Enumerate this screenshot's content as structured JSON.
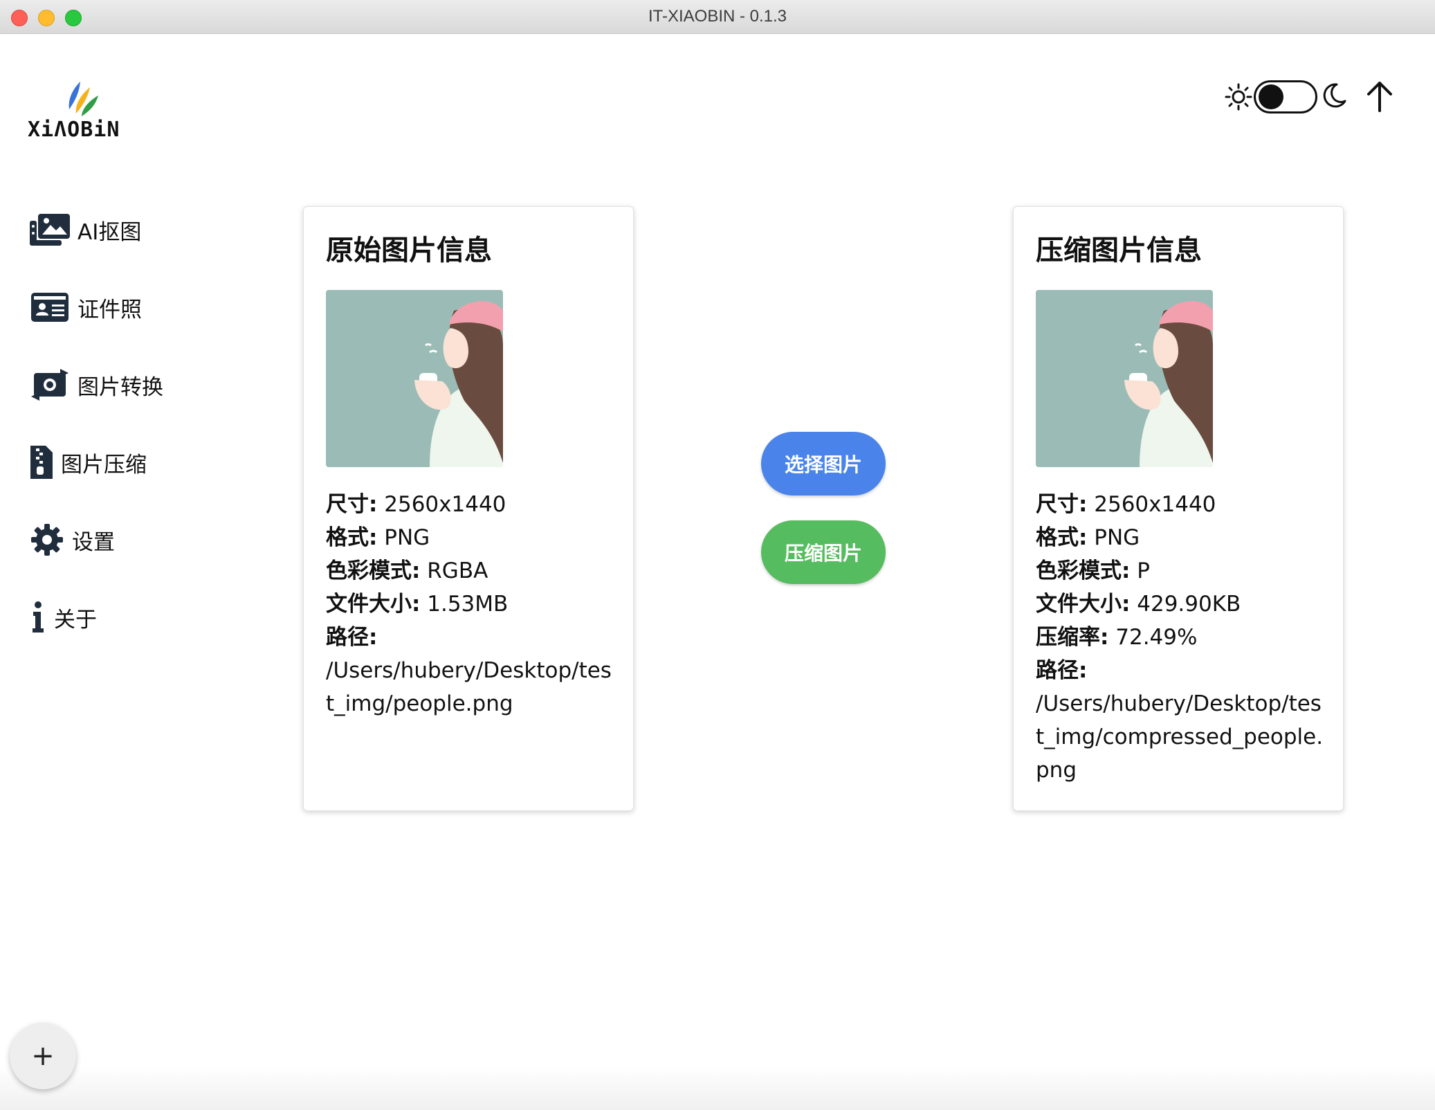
{
  "window": {
    "title": "IT-XIAOBIN - 0.1.3"
  },
  "logo": {
    "text": "XiΛOBiN"
  },
  "sidebar": {
    "items": [
      {
        "label": "AI抠图",
        "icon": "photo-gallery-icon"
      },
      {
        "label": "证件照",
        "icon": "id-card-icon"
      },
      {
        "label": "图片转换",
        "icon": "convert-camera-icon"
      },
      {
        "label": "图片压缩",
        "icon": "zip-file-icon"
      },
      {
        "label": "设置",
        "icon": "gear-icon"
      },
      {
        "label": "关于",
        "icon": "info-icon"
      }
    ]
  },
  "original": {
    "title": "原始图片信息",
    "size_label": "尺寸:",
    "size_value": " 2560x1440",
    "format_label": "格式:",
    "format_value": " PNG",
    "mode_label": "色彩模式:",
    "mode_value": " RGBA",
    "filesize_label": "文件大小:",
    "filesize_value": " 1.53MB",
    "path_label": "路径:",
    "path_value": "/Users/hubery/Desktop/test_img/people.png"
  },
  "compressed": {
    "title": "压缩图片信息",
    "size_label": "尺寸:",
    "size_value": " 2560x1440",
    "format_label": "格式:",
    "format_value": " PNG",
    "mode_label": "色彩模式:",
    "mode_value": " P",
    "filesize_label": "文件大小:",
    "filesize_value": " 429.90KB",
    "ratio_label": "压缩率:",
    "ratio_value": " 72.49%",
    "path_label": "路径:",
    "path_value": "/Users/hubery/Desktop/test_img/compressed_people.png"
  },
  "actions": {
    "select_label": "选择图片",
    "compress_label": "压缩图片"
  },
  "fab": {
    "label": "+"
  },
  "colors": {
    "select_button": "#4a84ea",
    "compress_button": "#55bc5f",
    "image_bg": "#9bbcb6"
  }
}
